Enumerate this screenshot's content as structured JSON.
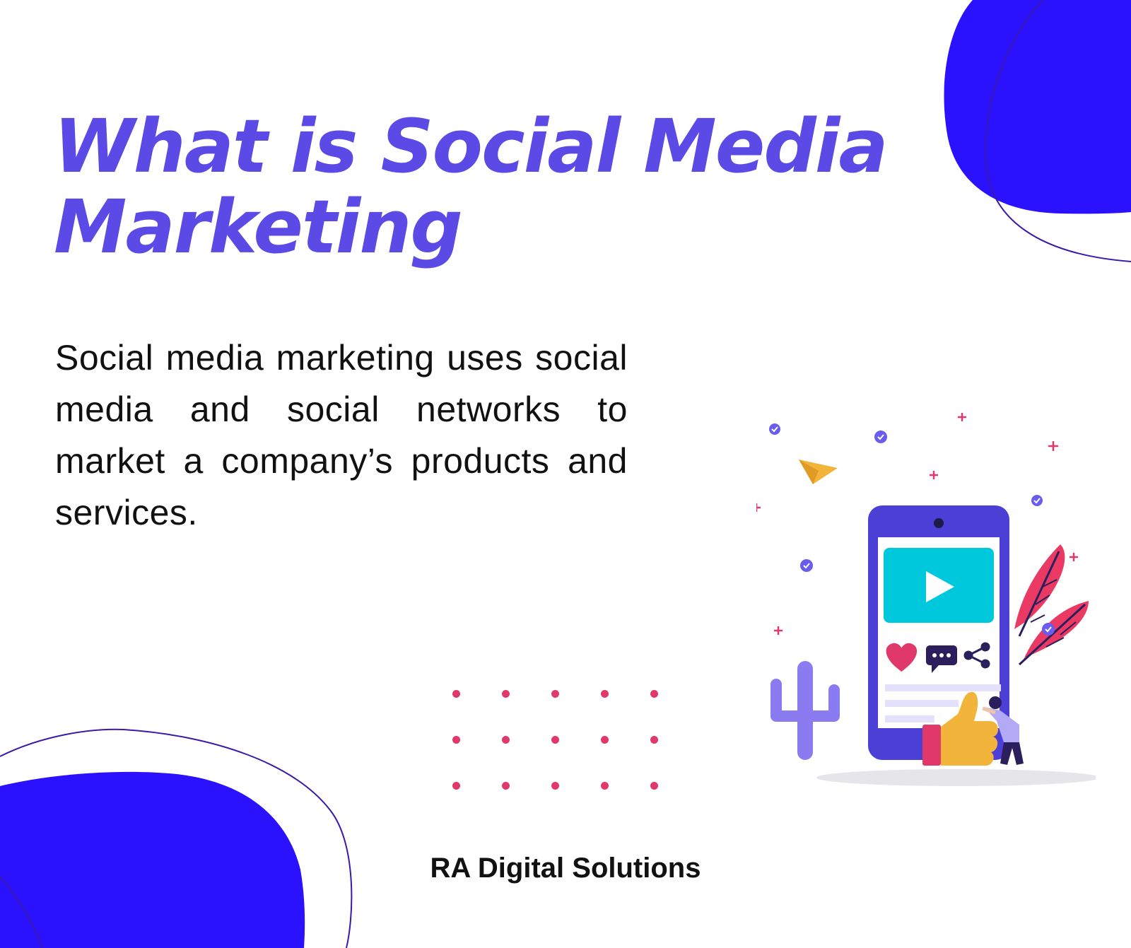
{
  "title": {
    "line1": "What is Social Media",
    "line2": "Marketing"
  },
  "description": "Social media marketing uses social media and social networks to market a company’s products and services.",
  "brand": "RA Digital Solutions",
  "colors": {
    "title": "#5b4ae6",
    "blob": "#2b12ff",
    "outline": "#3a1aa8",
    "dots": "#e0386a",
    "phone": "#4b3fd6",
    "phone_screen": "#ffffff",
    "video": "#00c8dc",
    "leaf": "#ea3a63",
    "thumb": "#f2b43a",
    "cactus": "#8a7cf0",
    "plane": "#f2b43a"
  },
  "icons": {
    "play": "play-icon",
    "heart": "heart-icon",
    "comment": "comment-icon",
    "share": "share-icon",
    "thumbs_up": "thumbs-up-icon",
    "paper_plane": "paper-plane-icon",
    "check": "check-badge-icon",
    "plus": "plus-icon"
  }
}
